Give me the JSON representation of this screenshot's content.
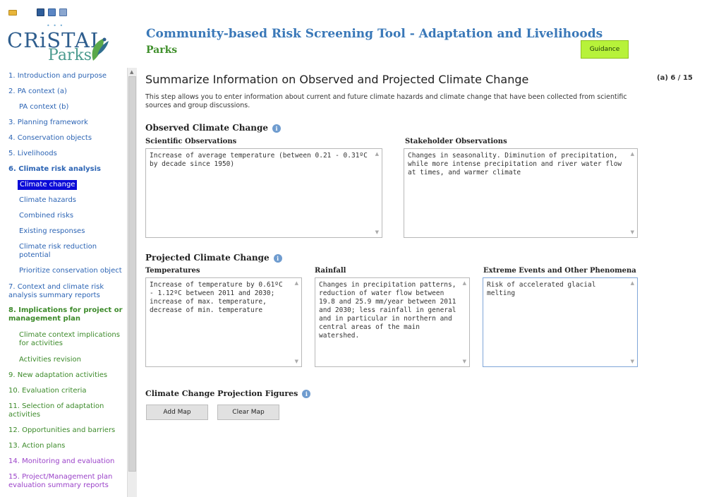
{
  "toolbar": {
    "icons": [
      "folder-icon",
      "save-icon",
      "edit-icon",
      "print-icon"
    ]
  },
  "logo": {
    "word": "CRiSTAL",
    "sub": "Parks"
  },
  "header": {
    "title": "Community-based Risk Screening Tool - Adaptation and Livelihoods",
    "subtitle": "Parks",
    "guidance_label": "Guidance"
  },
  "nav": {
    "items": [
      {
        "label": "1. Introduction and purpose"
      },
      {
        "label": "2. PA context (a)"
      },
      {
        "label": "PA context (b)"
      },
      {
        "label": "3. Planning framework"
      },
      {
        "label": "4. Conservation objects"
      },
      {
        "label": "5. Livelihoods"
      },
      {
        "label": "6. Climate risk analysis"
      },
      {
        "label": "Climate change"
      },
      {
        "label": "Climate hazards"
      },
      {
        "label": "Combined risks"
      },
      {
        "label": "Existing responses"
      },
      {
        "label": "Climate risk reduction potential"
      },
      {
        "label": "Prioritize conservation object"
      },
      {
        "label": "7. Context and climate risk analysis summary reports"
      },
      {
        "label": "8. Implications for project or management plan"
      },
      {
        "label": "Climate context implications for activities"
      },
      {
        "label": "Activities revision"
      },
      {
        "label": "9. New adaptation activities"
      },
      {
        "label": "10. Evaluation criteria"
      },
      {
        "label": "11. Selection of adaptation activities"
      },
      {
        "label": "12. Opportunities and barriers"
      },
      {
        "label": "13. Action plans"
      },
      {
        "label": "14. Monitoring and evaluation"
      },
      {
        "label": "15. Project/Management plan evaluation summary reports"
      }
    ]
  },
  "main": {
    "heading": "Summarize Information on Observed and Projected Climate Change",
    "step_counter": "(a) 6 / 15",
    "intro": "This step allows you to enter information about current and future climate hazards and climate change that have been collected from scientific sources and group discussions.",
    "observed": {
      "title": "Observed Climate Change",
      "scientific_label": "Scientific Observations",
      "scientific_value": "Increase of average temperature (between 0.21 - 0.31ºC by decade since 1950)",
      "stakeholder_label": "Stakeholder Observations",
      "stakeholder_value": "Changes in seasonality. Diminution of precipitation, while more intense precipitation and river water flow at times, and warmer climate"
    },
    "projected": {
      "title": "Projected Climate Change",
      "temperatures_label": "Temperatures",
      "temperatures_value": "Increase of temperature by 0.61ºC - 1.12ºC between 2011 and 2030; increase of max. temperature, decrease of min. temperature",
      "rainfall_label": "Rainfall",
      "rainfall_value": "Changes in precipitation patterns, reduction of water flow between 19.8 and 25.9 mm/year between 2011 and 2030; less rainfall in general and in particular in northern and central areas of the main watershed.",
      "extreme_label": "Extreme Events and Other Phenomena",
      "extreme_value": "Risk of accelerated glacial melting"
    },
    "figures": {
      "title": "Climate Change Projection Figures",
      "add_map_label": "Add Map",
      "clear_map_label": "Clear Map"
    }
  },
  "colors": {
    "accent_blue": "#3a78b8",
    "accent_green": "#3f8f2b",
    "guidance_bg": "#b7f23a",
    "nav_selected_bg": "#0a0ad8"
  }
}
